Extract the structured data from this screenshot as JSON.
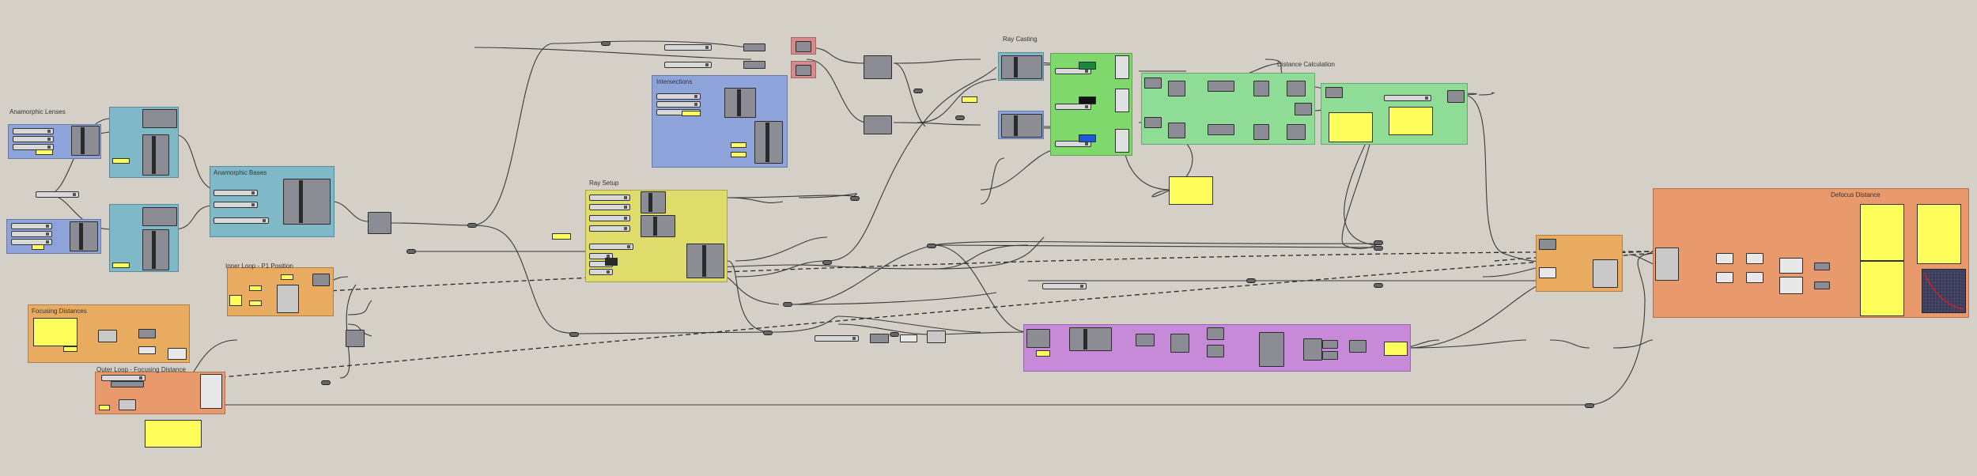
{
  "groups": {
    "anamorphic_lenses": "Anamorphic Lenses",
    "anamorphic_bases": "Anamorphic Bases",
    "inner_loop": "Inner Loop - P1 Position",
    "focusing_distances": "Focusing Distances",
    "outer_loop": "Outer Loop - Focusing Distance",
    "ray_setup": "Ray Setup",
    "intersections": "Intersections",
    "ray_casting": "Ray Casting",
    "distance_calc": "Distance Calculation",
    "defocus_distance": "Defocus Distance"
  },
  "colors": {
    "canvas": "#d4d0c8",
    "blue": "#8ea3da",
    "teal": "#7fb9c7",
    "yellow": "#dedc6a",
    "orange": "#e9ab5f",
    "salmon": "#e99a6c",
    "green": "#7fd86c",
    "lightgreen": "#8fdc97",
    "purple": "#c78ad8",
    "red": "#d88a8a",
    "panel": "#fefe5a"
  }
}
